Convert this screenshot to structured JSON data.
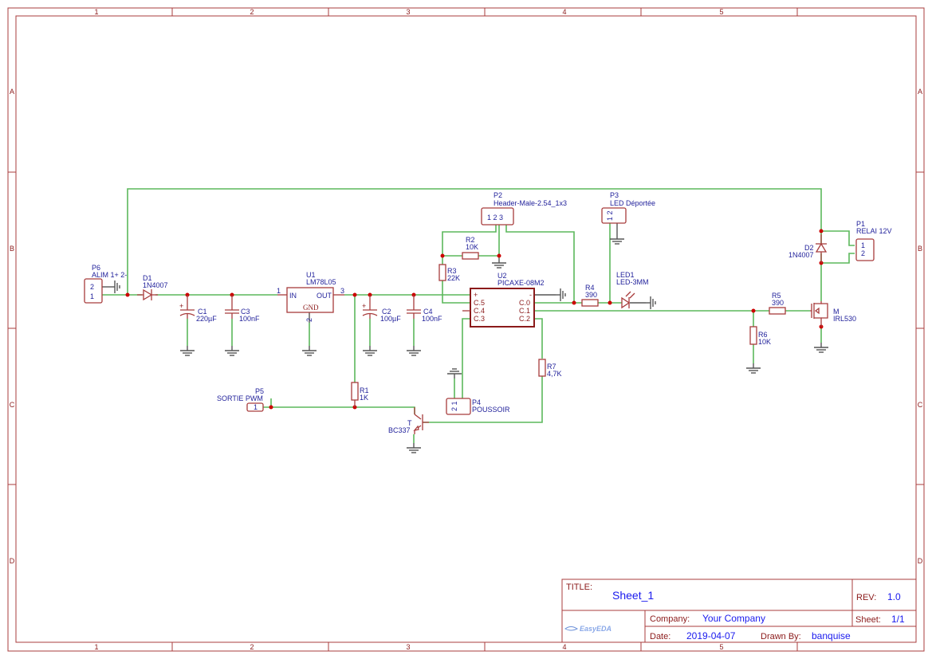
{
  "frame": {
    "columns": [
      "1",
      "2",
      "3",
      "4",
      "5"
    ],
    "rows": [
      "A",
      "B",
      "C",
      "D"
    ]
  },
  "components": {
    "P6": {
      "ref": "P6",
      "value": "ALIM 1+ 2-",
      "pins": [
        "2",
        "1"
      ]
    },
    "D1": {
      "ref": "D1",
      "value": "1N4007"
    },
    "C1": {
      "ref": "C1",
      "value": "220µF"
    },
    "C3": {
      "ref": "C3",
      "value": "100nF"
    },
    "U1": {
      "ref": "U1",
      "value": "LM78L05",
      "pin_in": "IN",
      "pin_out": "OUT",
      "pin_gnd": "GND",
      "pin1": "1",
      "pin2": "2",
      "pin3": "3"
    },
    "C2": {
      "ref": "C2",
      "value": "100µF"
    },
    "C4": {
      "ref": "C4",
      "value": "100nF"
    },
    "R1": {
      "ref": "R1",
      "value": "1K"
    },
    "P5": {
      "ref": "P5",
      "value": "SORTIE PWM",
      "pin": "1"
    },
    "T": {
      "ref": "T",
      "value": "BC337"
    },
    "P2": {
      "ref": "P2",
      "value": "Header-Male-2.54_1x3",
      "pins": "1 2 3"
    },
    "R2": {
      "ref": "R2",
      "value": "10K"
    },
    "R3": {
      "ref": "R3",
      "value": "22K"
    },
    "U2": {
      "ref": "U2",
      "value": "PICAXE-08M2",
      "left_pins": [
        "+",
        "C.5",
        "C.4",
        "C.3"
      ],
      "right_pins": [
        "-",
        "C.0",
        "C.1",
        "C.2"
      ]
    },
    "P4": {
      "ref": "P4",
      "value": "POUSSOIR",
      "pins": "2 1"
    },
    "R7": {
      "ref": "R7",
      "value": "4,7K"
    },
    "P3": {
      "ref": "P3",
      "value": "LED Déportée",
      "pins": "1 2"
    },
    "R4": {
      "ref": "R4",
      "value": "390"
    },
    "LED1": {
      "ref": "LED1",
      "value": "LED-3MM"
    },
    "R5": {
      "ref": "R5",
      "value": "390"
    },
    "R6": {
      "ref": "R6",
      "value": "10K"
    },
    "M": {
      "ref": "M",
      "value": "IRL530"
    },
    "D2": {
      "ref": "D2",
      "value": "1N4007"
    },
    "P1": {
      "ref": "P1",
      "value": "RELAI 12V",
      "pins": [
        "1",
        "2"
      ]
    }
  },
  "title_block": {
    "title_label": "TITLE:",
    "title": "Sheet_1",
    "rev_label": "REV:",
    "rev": "1.0",
    "company_label": "Company:",
    "company": "Your Company",
    "sheet_label": "Sheet:",
    "sheet": "1/1",
    "date_label": "Date:",
    "date": "2019-04-07",
    "drawn_label": "Drawn By:",
    "drawn_by": "banquise",
    "logo": "EasyEDA"
  },
  "colors": {
    "wire": "#5cb85c",
    "component": "#a83c3c",
    "label": "#1f1f9a",
    "junction": "#cc0000",
    "frame": "#a83c3c"
  }
}
